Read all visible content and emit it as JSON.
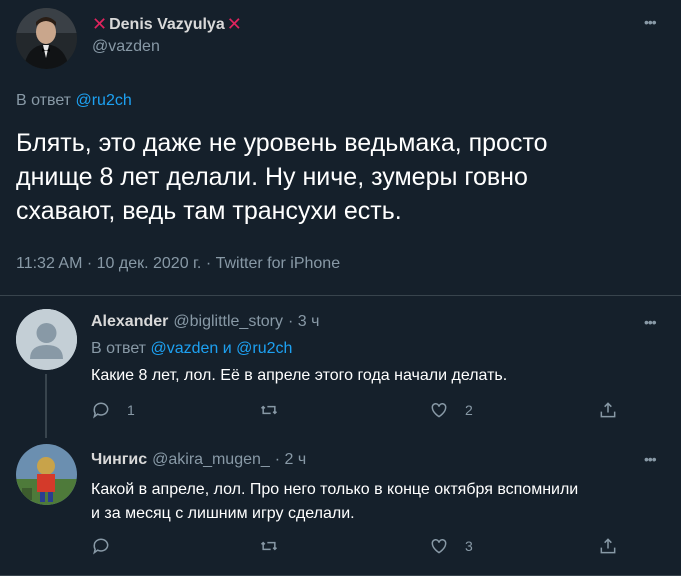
{
  "main_tweet": {
    "display_name": "Denis Vazyulya",
    "handle": "@vazden",
    "reply_prefix": "В ответ",
    "reply_to": "@ru2ch",
    "text_line1": "Блять, это даже не уровень ведьмака, просто",
    "text_line2": "днище 8 лет делали. Ну ниче, зумеры говно",
    "text_line3": "схавают, ведь там трансухи есть.",
    "timestamp": "11:32 AM · 10 дек. 2020 г. · Twitter for iPhone"
  },
  "replies": [
    {
      "display_name": "Alexander",
      "handle": "@biglittle_story",
      "time": "· 3 ч",
      "reply_prefix": "В ответ",
      "reply_to_1": "@vazden",
      "reply_and": "и",
      "reply_to_2": "@ru2ch",
      "text": "Какие 8 лет, лол. Её в апреле этого года начали делать.",
      "reply_count": "1",
      "like_count": "2"
    },
    {
      "display_name": "Чингис",
      "handle": "@akira_mugen_",
      "time": "· 2 ч",
      "text_line1": "Какой в апреле, лол. Про него только в конце октября вспомнили",
      "text_line2": "и за месяц с лишним игру сделали.",
      "like_count": "3"
    }
  ],
  "colors": {
    "background": "#15202b",
    "text": "#d9d9d9",
    "muted": "#8899a6",
    "link": "#1da1f2",
    "divider": "#38444d",
    "red_x": "#e0245e"
  }
}
